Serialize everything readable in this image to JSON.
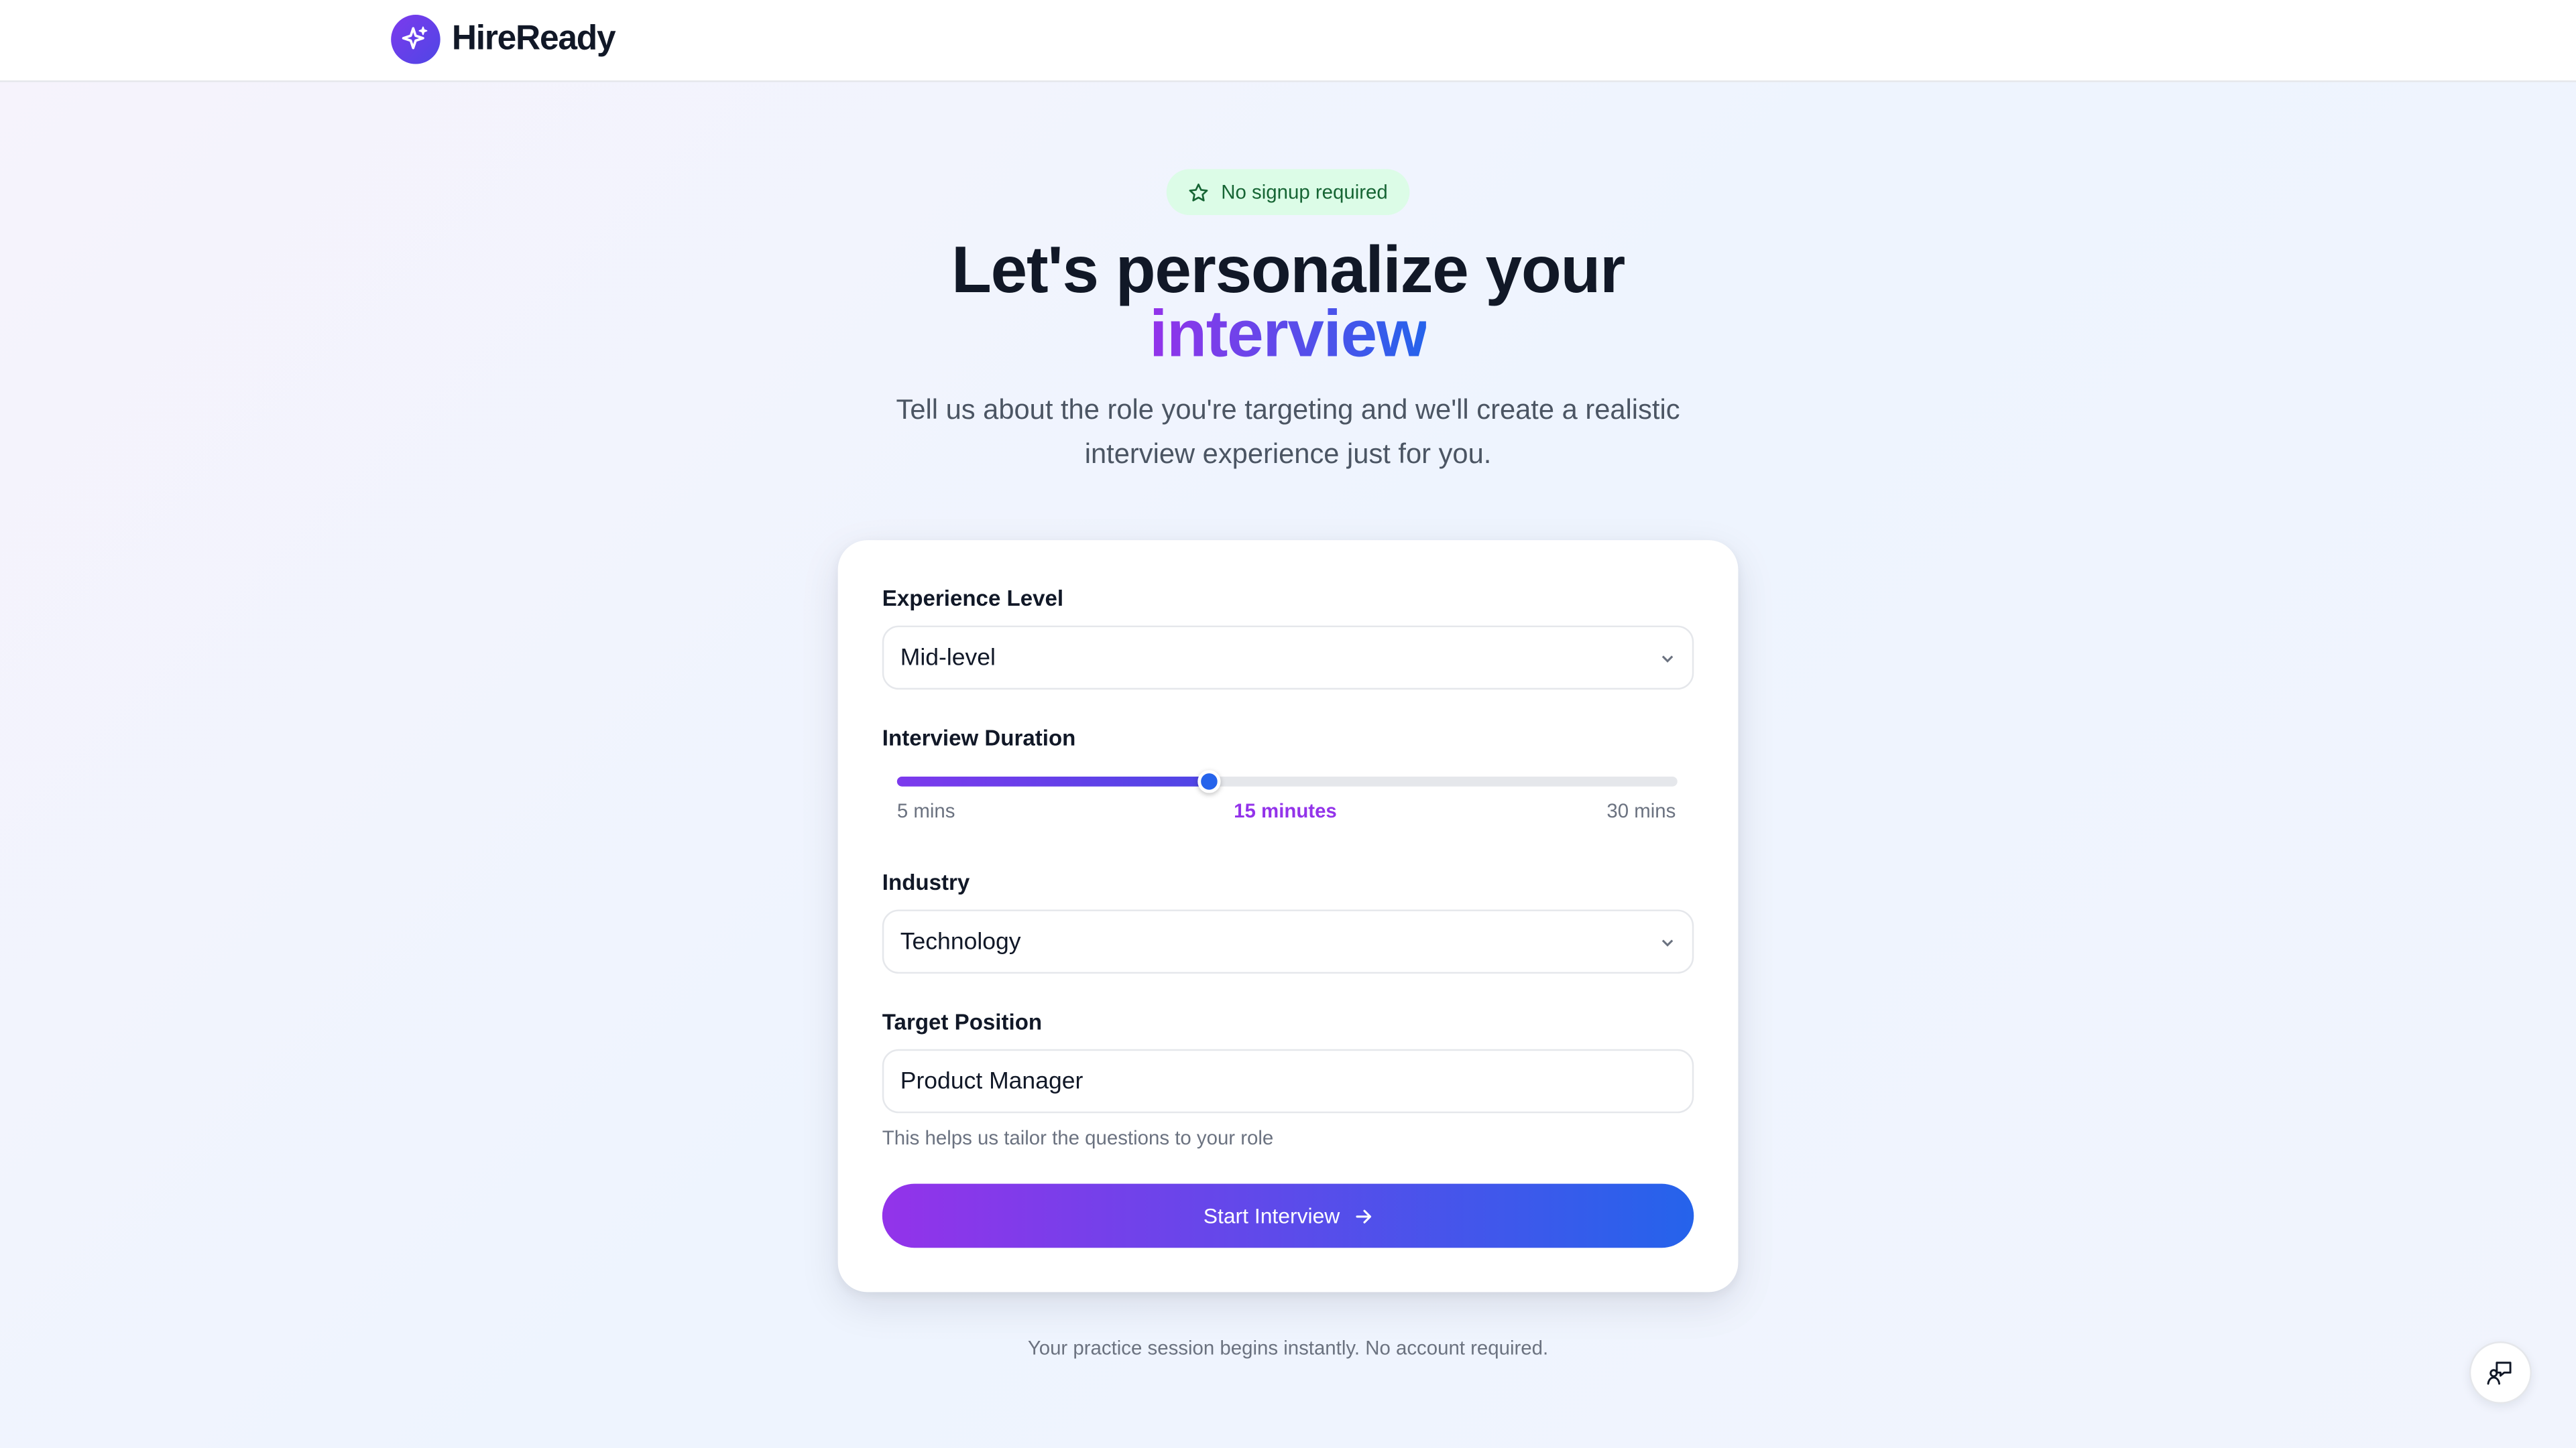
{
  "brand": {
    "name": "HireReady",
    "icon": "sparkle-icon",
    "accent": "#7c3aed"
  },
  "hero": {
    "badge": "No signup required",
    "badge_icon": "star-icon",
    "title_line1": "Let's personalize your",
    "title_highlight": "interview",
    "subtitle": "Tell us about the role you're targeting and we'll create a realistic interview experience just for you."
  },
  "form": {
    "experience": {
      "label": "Experience Level",
      "value": "Mid-level"
    },
    "duration": {
      "label": "Interview Duration",
      "min_label": "5 mins",
      "current_label": "15 minutes",
      "max_label": "30 mins",
      "min": 5,
      "max": 30,
      "value": 15
    },
    "industry": {
      "label": "Industry",
      "value": "Technology"
    },
    "position": {
      "label": "Target Position",
      "value": "Product Manager",
      "hint": "This helps us tailor the questions to your role"
    },
    "submit_label": "Start Interview"
  },
  "footer": {
    "note": "Your practice session begins instantly. No account required."
  },
  "colors": {
    "gradient_start": "#9333ea",
    "gradient_end": "#2563eb",
    "badge_bg": "#dcfce7",
    "badge_text": "#166534"
  }
}
